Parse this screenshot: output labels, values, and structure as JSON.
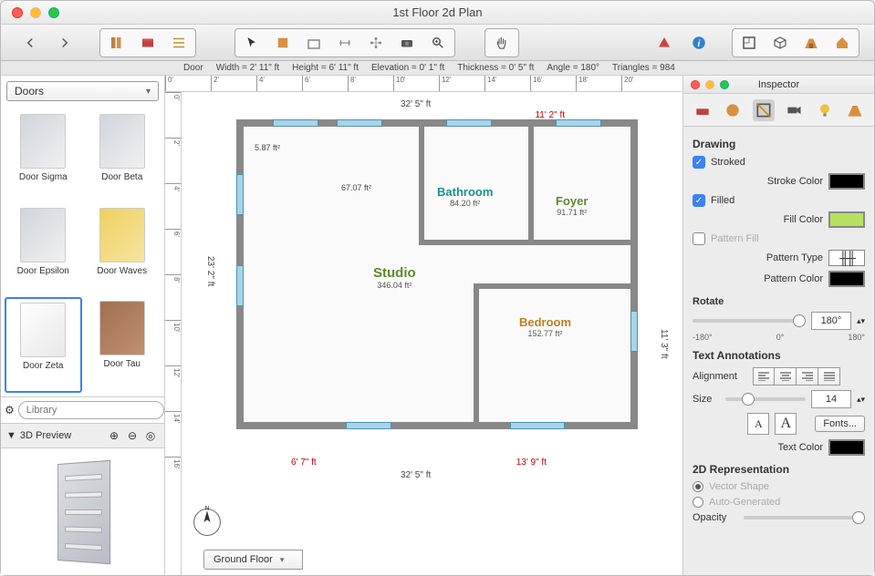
{
  "window": {
    "title": "1st Floor 2d Plan"
  },
  "status": {
    "object": "Door",
    "width": "Width = 2' 11\" ft",
    "height": "Height = 6' 11\" ft",
    "elevation": "Elevation = 0' 1\" ft",
    "thickness": "Thickness = 0' 5\" ft",
    "angle": "Angle = 180°",
    "triangles": "Triangles = 984"
  },
  "sidebar": {
    "category": "Doors",
    "search_placeholder": "Library",
    "items": [
      {
        "label": "Door Sigma",
        "sel": false,
        "style": ""
      },
      {
        "label": "Door Beta",
        "sel": false,
        "style": ""
      },
      {
        "label": "Door Epsilon",
        "sel": false,
        "style": ""
      },
      {
        "label": "Door Waves",
        "sel": false,
        "style": "yellow"
      },
      {
        "label": "Door Zeta",
        "sel": true,
        "style": "white"
      },
      {
        "label": "Door Tau",
        "sel": false,
        "style": "brown"
      }
    ],
    "preview_title": "3D Preview"
  },
  "floorplan": {
    "floor_selector": "Ground Floor",
    "outer_w": "32' 5\" ft",
    "outer_h": "23' 2\" ft",
    "right_upper": "11' 3\" ft",
    "right_dim": "11' 2\" ft",
    "bottom_left": "6' 7\" ft",
    "bottom_right": "13' 9\" ft",
    "note": "5.87 ft²",
    "hall_area": "67.07 ft²",
    "rooms": {
      "bathroom": {
        "name": "Bathroom",
        "area": "84.20 ft²",
        "color": "#1a9090"
      },
      "foyer": {
        "name": "Foyer",
        "area": "91.71 ft²",
        "color": "#608830"
      },
      "studio": {
        "name": "Studio",
        "area": "346.04 ft²",
        "color": "#608830"
      },
      "bedroom": {
        "name": "Bedroom",
        "area": "152.77 ft²",
        "color": "#c08020"
      }
    }
  },
  "inspector": {
    "title": "Inspector",
    "drawing": {
      "header": "Drawing",
      "stroked_label": "Stroked",
      "stroked": true,
      "stroke_color_label": "Stroke Color",
      "filled_label": "Filled",
      "filled": true,
      "fill_color_label": "Fill Color",
      "pattern_fill_label": "Pattern Fill",
      "pattern_fill": false,
      "pattern_type_label": "Pattern Type",
      "pattern_color_label": "Pattern Color"
    },
    "rotate": {
      "label": "Rotate",
      "value": "180°",
      "min": "-180°",
      "mid": "0°",
      "max": "180°"
    },
    "text": {
      "header": "Text Annotations",
      "align_label": "Alignment",
      "size_label": "Size",
      "size_value": "14",
      "fonts_label": "Fonts...",
      "text_color_label": "Text Color"
    },
    "rep": {
      "header": "2D Representation",
      "vector_label": "Vector Shape",
      "auto_label": "Auto-Generated",
      "opacity_label": "Opacity"
    }
  },
  "ruler": {
    "h": [
      "0'",
      "2'",
      "4'",
      "6'",
      "8'",
      "10'",
      "12'",
      "14'",
      "16'",
      "18'",
      "20'"
    ],
    "v": [
      "0'",
      "2'",
      "4'",
      "6'",
      "8'",
      "10'",
      "12'",
      "14'",
      "16'"
    ]
  }
}
